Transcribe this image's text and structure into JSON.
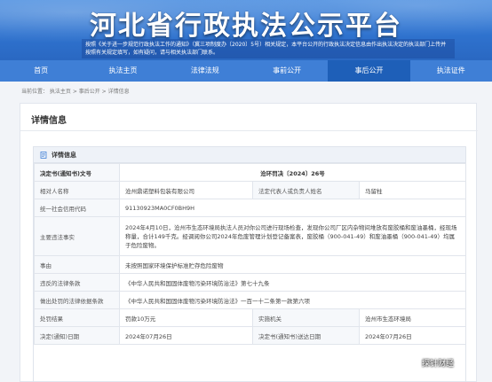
{
  "banner": {
    "title": "河北省行政执法公示平台",
    "notice": "按照《关于进一步规范行政执法工作的通知》（冀三项制度办〔2020〕5号）相关规定，本平台公开的行政执法决定信息由作出执法决定的执法部门上传并按照有关规定填写，如有疑问，请与相关执法部门联系。"
  },
  "nav": {
    "items": [
      {
        "label": "首页",
        "active": false
      },
      {
        "label": "执法主页",
        "active": false
      },
      {
        "label": "法律法规",
        "active": false
      },
      {
        "label": "事前公开",
        "active": false
      },
      {
        "label": "事后公开",
        "active": true
      },
      {
        "label": "执法证件",
        "active": false
      }
    ]
  },
  "breadcrumb": "当前位置： 执法主页 > 事后公开 > 详情信息",
  "card": {
    "title": "详情信息",
    "panel_title": "详情信息"
  },
  "table": {
    "doc_label": "决定书(通知书)文号",
    "doc_value": "沧环罚决〔2024〕26号",
    "party_label": "相对人名称",
    "party_value": "沧州鼎诺塑料包装有限公司",
    "legal_rep_label": "法定代表人或负责人姓名",
    "legal_rep_value": "马留柱",
    "credit_label": "统一社会信用代码",
    "credit_value": "91130923MA0CF0BH9H",
    "facts_label": "主要违法事实",
    "facts_value": "2024年4月10日，沧州市生态环境局执法人员对你公司进行现场检查，发现你公司厂区内杂物间堆放有废胶桶和废油墨桶，经现场称量，合计149千克。经调阅你公司2024年危废管理计划登记备案表，废胶桶（900-041-49）和废油墨桶（900-041-49）均属于危险废物。",
    "reason_label": "事由",
    "reason_value": "未按照国家环境保护标准贮存危险废物",
    "violated_label": "违反的法律条款",
    "violated_value": "《中华人民共和国固体废物污染环境防治法》第七十九条",
    "basis_label": "做出处罚的法律依据条款",
    "basis_value": "《中华人民共和国固体废物污染环境防治法》一百一十二条第一款第六项",
    "result_label": "处罚结果",
    "result_value": "罚款10万元",
    "org_label": "实施机关",
    "org_value": "沧州市生态环境局",
    "date_label": "决定(通知)日期",
    "date_value": "2024年07月26日",
    "delivery_label": "决定书(通知书)送达日期",
    "delivery_value": "2024年07月26日"
  },
  "watermark": "探针财经"
}
